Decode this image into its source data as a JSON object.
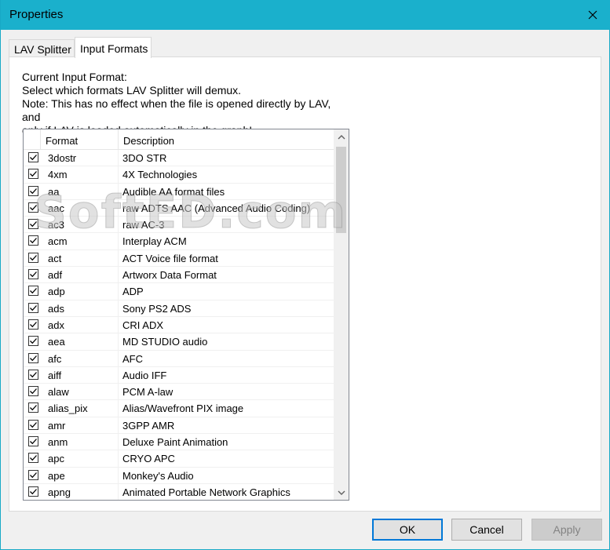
{
  "window": {
    "title": "Properties"
  },
  "tabs": [
    {
      "label": "LAV Splitter",
      "active": false
    },
    {
      "label": "Input Formats",
      "active": true
    }
  ],
  "group": {
    "title": "Current Input Format:",
    "lines": [
      "Select which formats LAV Splitter will demux.",
      "Note: This has no effect when the file is opened directly by LAV, and",
      "only if LAV is loaded automatically in the graph!"
    ]
  },
  "list": {
    "columns": [
      "Format",
      "Description"
    ],
    "rows": [
      {
        "format": "3dostr",
        "description": "3DO STR",
        "checked": true
      },
      {
        "format": "4xm",
        "description": "4X Technologies",
        "checked": true
      },
      {
        "format": "aa",
        "description": "Audible AA format files",
        "checked": true
      },
      {
        "format": "aac",
        "description": "raw ADTS AAC (Advanced Audio Coding)",
        "checked": true
      },
      {
        "format": "ac3",
        "description": "raw AC-3",
        "checked": true
      },
      {
        "format": "acm",
        "description": "Interplay ACM",
        "checked": true
      },
      {
        "format": "act",
        "description": "ACT Voice file format",
        "checked": true
      },
      {
        "format": "adf",
        "description": "Artworx Data Format",
        "checked": true
      },
      {
        "format": "adp",
        "description": "ADP",
        "checked": true
      },
      {
        "format": "ads",
        "description": "Sony PS2 ADS",
        "checked": true
      },
      {
        "format": "adx",
        "description": "CRI ADX",
        "checked": true
      },
      {
        "format": "aea",
        "description": "MD STUDIO audio",
        "checked": true
      },
      {
        "format": "afc",
        "description": "AFC",
        "checked": true
      },
      {
        "format": "aiff",
        "description": "Audio IFF",
        "checked": true
      },
      {
        "format": "alaw",
        "description": "PCM A-law",
        "checked": true
      },
      {
        "format": "alias_pix",
        "description": "Alias/Wavefront PIX image",
        "checked": true
      },
      {
        "format": "amr",
        "description": "3GPP AMR",
        "checked": true
      },
      {
        "format": "anm",
        "description": "Deluxe Paint Animation",
        "checked": true
      },
      {
        "format": "apc",
        "description": "CRYO APC",
        "checked": true
      },
      {
        "format": "ape",
        "description": "Monkey's Audio",
        "checked": true
      },
      {
        "format": "apng",
        "description": "Animated Portable Network Graphics",
        "checked": true
      }
    ]
  },
  "watermark": "SoftED.com",
  "buttons": {
    "ok": "OK",
    "cancel": "Cancel",
    "apply": "Apply"
  },
  "icons": {
    "close": "close-icon",
    "check": "checkmark-icon",
    "scroll_up": "chevron-up-icon",
    "scroll_down": "chevron-down-icon"
  },
  "colors": {
    "titlebar": "#1ab0cc",
    "accent": "#0078d7"
  }
}
